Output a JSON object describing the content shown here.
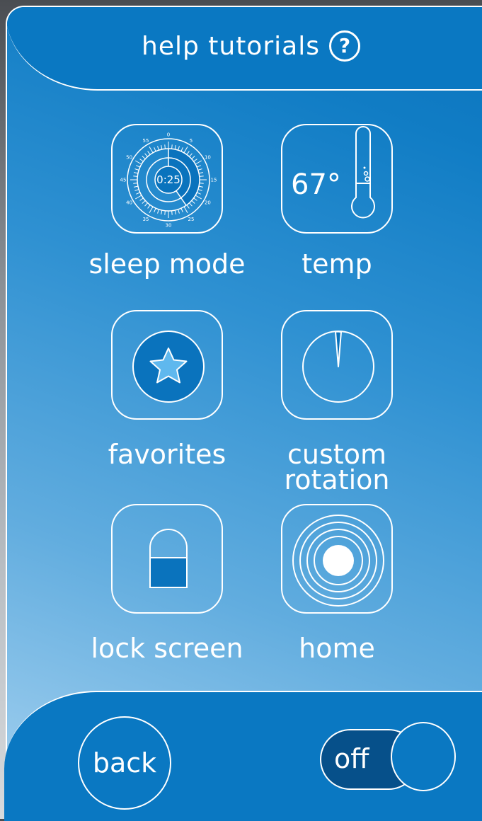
{
  "header": {
    "title": "help tutorials",
    "help_icon": "question-mark-icon",
    "help_glyph": "?"
  },
  "tiles": [
    {
      "label": "sleep mode",
      "icon": "timer-dial-icon",
      "timer_display": "0:25",
      "dial_numbers": [
        "0",
        "5",
        "10",
        "15",
        "20",
        "25",
        "30",
        "35",
        "40",
        "45",
        "50",
        "55"
      ]
    },
    {
      "label": "temp",
      "icon": "thermometer-icon",
      "temperature": "67°"
    },
    {
      "label": "favorites",
      "icon": "star-icon"
    },
    {
      "label_line1": "custom",
      "label_line2": "rotation",
      "icon": "rotation-pie-icon"
    },
    {
      "label": "lock screen",
      "icon": "lock-icon"
    },
    {
      "label": "home",
      "icon": "concentric-circles-icon"
    }
  ],
  "footer": {
    "back_label": "back",
    "toggle_label": "off",
    "toggle_state": "off"
  },
  "colors": {
    "bar_blue": "#0a78c2",
    "toggle_dark": "#06508a",
    "white": "#ffffff"
  }
}
